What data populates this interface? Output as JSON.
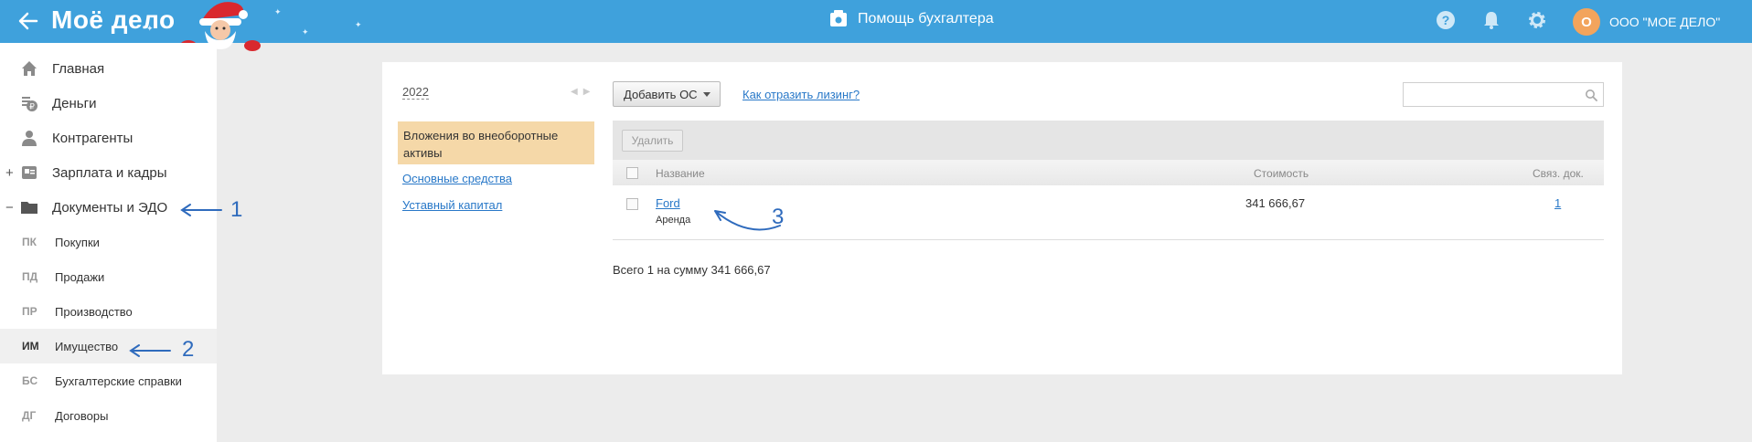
{
  "header": {
    "logo": "Моё дело",
    "help_label": "Помощь бухгалтера",
    "org_initial": "О",
    "org_name": "ООО \"МОЕ ДЕЛО\"",
    "accent_color": "#3fa1dc",
    "icons": [
      "back-arrow-icon",
      "santa-decoration",
      "help-book-icon",
      "question-icon",
      "bell-icon",
      "gear-icon"
    ]
  },
  "sidebar": {
    "items": [
      {
        "label": "Главная",
        "icon": "home-icon"
      },
      {
        "label": "Деньги",
        "icon": "money-icon"
      },
      {
        "label": "Контрагенты",
        "icon": "contractors-icon"
      },
      {
        "label": "Зарплата и кадры",
        "icon": "salary-icon",
        "toggle": "+"
      },
      {
        "label": "Документы и ЭДО",
        "icon": "folder-icon",
        "toggle": "−"
      }
    ],
    "sub_items": [
      {
        "abbr": "ПК",
        "label": "Покупки"
      },
      {
        "abbr": "ПД",
        "label": "Продажи"
      },
      {
        "abbr": "ПР",
        "label": "Производство"
      },
      {
        "abbr": "ИМ",
        "label": "Имущество"
      },
      {
        "abbr": "БС",
        "label": "Бухгалтерские справки"
      },
      {
        "abbr": "ДГ",
        "label": "Договоры"
      }
    ]
  },
  "annotations": [
    "1",
    "2",
    "3"
  ],
  "filters": {
    "year": "2022",
    "active": "Вложения во внеоборотные активы",
    "links": [
      "Основные средства",
      "Уставный капитал"
    ]
  },
  "actions": {
    "add_label": "Добавить ОС",
    "lease_link": "Как отразить лизинг?",
    "search_placeholder": "",
    "delete_label": "Удалить"
  },
  "table": {
    "columns": [
      "Название",
      "Стоимость",
      "Связ. док."
    ],
    "rows": [
      {
        "name": "Ford",
        "sub": "Аренда",
        "cost": "341 666,67",
        "docs": "1"
      }
    ],
    "total": "Всего 1 на сумму 341 666,67"
  }
}
